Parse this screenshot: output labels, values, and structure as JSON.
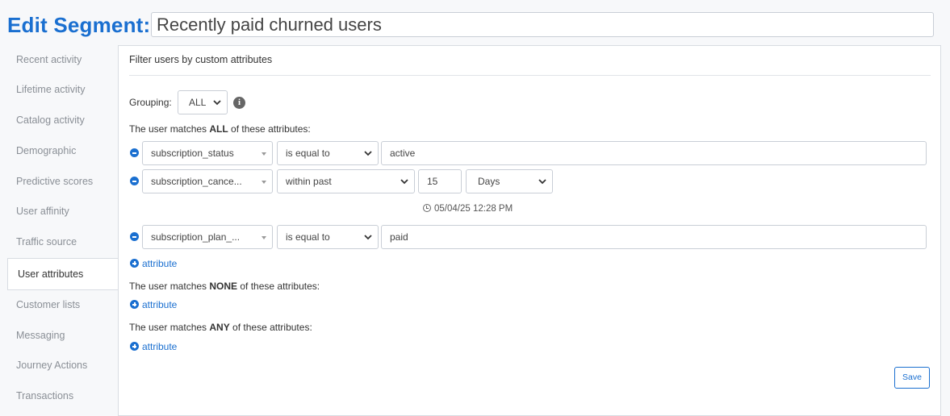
{
  "header": {
    "title": "Edit Segment:",
    "segment_name": "Recently paid churned users"
  },
  "sidebar": {
    "items": [
      {
        "label": "Recent activity"
      },
      {
        "label": "Lifetime activity"
      },
      {
        "label": "Catalog activity"
      },
      {
        "label": "Demographic"
      },
      {
        "label": "Predictive scores"
      },
      {
        "label": "User affinity"
      },
      {
        "label": "Traffic source"
      },
      {
        "label": "User attributes",
        "active": true
      },
      {
        "label": "Customer lists"
      },
      {
        "label": "Messaging"
      },
      {
        "label": "Journey Actions"
      },
      {
        "label": "Transactions"
      }
    ]
  },
  "panel": {
    "title": "Filter users by custom attributes",
    "grouping_label": "Grouping:",
    "grouping_value": "ALL",
    "all_section": {
      "prefix": "The user matches ",
      "keyword": "ALL",
      "suffix": " of these attributes:"
    },
    "none_section": {
      "prefix": "The user matches ",
      "keyword": "NONE",
      "suffix": " of these attributes:"
    },
    "any_section": {
      "prefix": "The user matches ",
      "keyword": "ANY",
      "suffix": " of these attributes:"
    },
    "rows": [
      {
        "attribute": "subscription_status",
        "operator": "is equal to",
        "value": "active"
      },
      {
        "attribute": "subscription_cance...",
        "operator": "within past",
        "value": "15",
        "unit": "Days",
        "timestamp": "05/04/25 12:28 PM"
      },
      {
        "attribute": "subscription_plan_...",
        "operator": "is equal to",
        "value": "paid"
      }
    ],
    "add_attribute_label": "attribute",
    "save_label": "Save"
  },
  "colors": {
    "accent": "#1a6fd0",
    "sidebar_bg": "#f7f8fa",
    "panel_bg": "#ffffff"
  }
}
